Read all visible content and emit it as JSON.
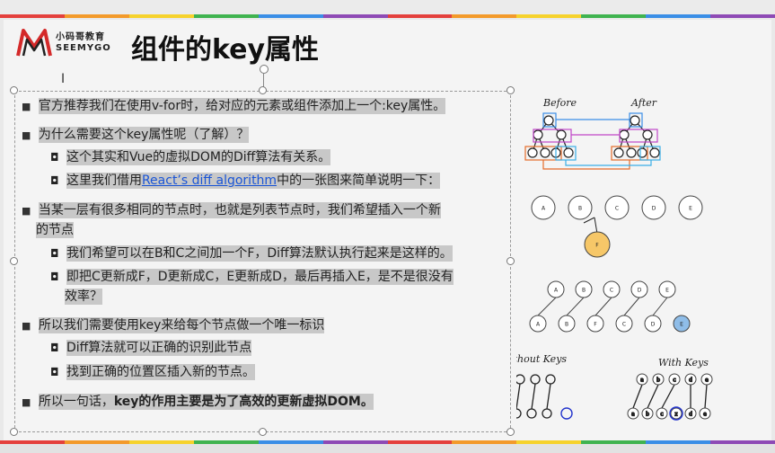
{
  "colors": {
    "stripe": [
      "#e4403c",
      "#f39a2a",
      "#f6d22c",
      "#3fb34f",
      "#3a8ee6",
      "#8e4ab5",
      "#e4403c",
      "#f39a2a",
      "#f6d22c",
      "#3fb34f",
      "#3a8ee6",
      "#8e4ab5"
    ],
    "highlight": "#c8c8c8",
    "link": "#1a55d6",
    "node_f": "#f6c768",
    "node_blue": "#8fbde8"
  },
  "logo": {
    "zh": "小码哥教育",
    "en": "SEEMYGO"
  },
  "title": "组件的key属性",
  "bullets": [
    {
      "level": 1,
      "text": "官方推荐我们在使用v-for时，给对应的元素或组件添加上一个:key属性。"
    },
    {
      "level": 1,
      "text": "为什么需要这个key属性呢（了解）？"
    },
    {
      "level": 2,
      "text": "这个其实和Vue的虚拟DOM的Diff算法有关系。"
    },
    {
      "level": 2,
      "pre": "这里我们借用",
      "link": "React’s diff algorithm",
      "post": "中的一张图来简单说明一下："
    },
    {
      "level": 1,
      "text": "当某一层有很多相同的节点时，也就是列表节点时，我们希望插入一个新",
      "cont": "的节点"
    },
    {
      "level": 2,
      "text": "我们希望可以在B和C之间加一个F，Diff算法默认执行起来是这样的。"
    },
    {
      "level": 2,
      "text": "即把C更新成F，D更新成C，E更新成D，最后再插入E，是不是很没有",
      "cont": "效率？"
    },
    {
      "level": 1,
      "text": "所以我们需要使用key来给每个节点做一个唯一标识"
    },
    {
      "level": 2,
      "text": "Diff算法就可以正确的识别此节点"
    },
    {
      "level": 2,
      "text": "找到正确的位置区插入新的节点。"
    },
    {
      "level": 1,
      "pre": "所以一句话，",
      "bold": "key的作用主要是为了高效的更新虚拟DOM。"
    }
  ],
  "diagram": {
    "before_label": "Before",
    "after_label": "After",
    "row1": [
      "A",
      "B",
      "C",
      "D",
      "E"
    ],
    "inserted": "F",
    "row2_top": [
      "A",
      "B",
      "C",
      "D",
      "E"
    ],
    "row2_bottom": [
      "A",
      "B",
      "F",
      "C",
      "D",
      "E"
    ],
    "without_keys": "Without Keys",
    "with_keys": "With Keys",
    "wk_top": [
      "a",
      "b",
      "c",
      "d",
      "e"
    ],
    "wk_bottom": [
      "a",
      "b",
      "c",
      "z",
      "d",
      "e"
    ]
  }
}
